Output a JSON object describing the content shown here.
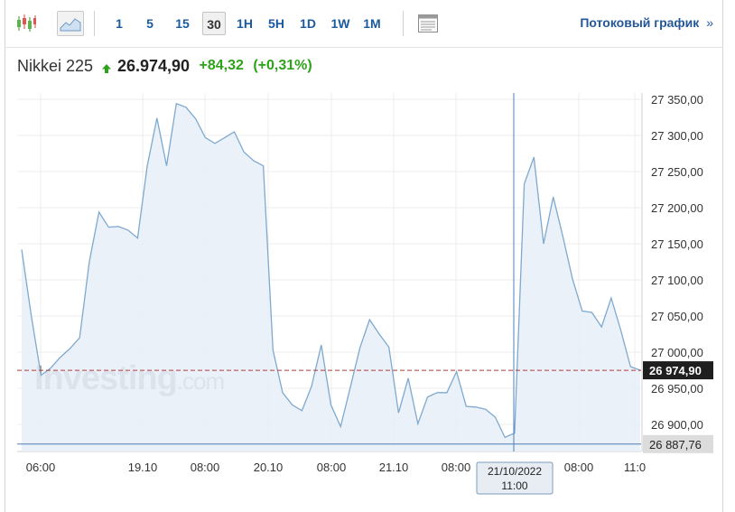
{
  "toolbar": {
    "chart_type_icons": [
      "candlestick-icon",
      "area-chart-icon"
    ],
    "timeframes": [
      "1",
      "5",
      "15",
      "30",
      "1H",
      "5H",
      "1D",
      "1W",
      "1M"
    ],
    "selected_timeframe": "30",
    "stream_label": "Потоковый график",
    "stream_chevron": "»"
  },
  "quote": {
    "name": "Nikkei 225",
    "price": "26.974,90",
    "change": "+84,32",
    "change_pct": "(+0,31%)",
    "up_color": "#2fa21b"
  },
  "watermark": {
    "brand": "Investing",
    "suffix": ".com"
  },
  "chart_data": {
    "type": "area",
    "y_ticks": [
      "27 350,00",
      "27 300,00",
      "27 250,00",
      "27 200,00",
      "27 150,00",
      "27 100,00",
      "27 050,00",
      "27 000,00",
      "26 950,00",
      "26 900,00"
    ],
    "ylim": [
      26860,
      27375
    ],
    "x_tick_labels": [
      "06:00",
      "19.10",
      "08:00",
      "20.10",
      "08:00",
      "21.10",
      "08:00",
      "08:00",
      "11:0"
    ],
    "last_value_label": "26 974,90",
    "last_value": 26974.9,
    "crosshair": {
      "y_label": "26 887,76",
      "y_value": 26887.76,
      "date": "21/10/2022",
      "time": "11:00"
    },
    "series": [
      {
        "values": [
          27142,
          27050,
          26968,
          26978,
          26993,
          27005,
          27020,
          27125,
          27194,
          27173,
          27174,
          27169,
          27158,
          27258,
          27324,
          27258,
          27344,
          27339,
          27323,
          27297,
          27289,
          27297,
          27305,
          27277,
          27265,
          27258,
          27003,
          26944,
          26927,
          26919,
          26953,
          27010,
          26927,
          26897,
          26951,
          27006,
          27045,
          27025,
          27007,
          26916,
          26964,
          26901,
          26938,
          26944,
          26944,
          26973,
          26925,
          26924,
          26921,
          26910,
          26882,
          26888,
          27233,
          27270,
          27150,
          27215,
          27160,
          27101,
          27057,
          27055,
          27035,
          27075,
          27030,
          26980,
          26975
        ]
      }
    ],
    "colors": {
      "line": "#7fa9cf",
      "fill": "#e6eff8",
      "last_line": "#b03a3a",
      "crosshair": "#4e7fb4"
    },
    "grid": true
  }
}
